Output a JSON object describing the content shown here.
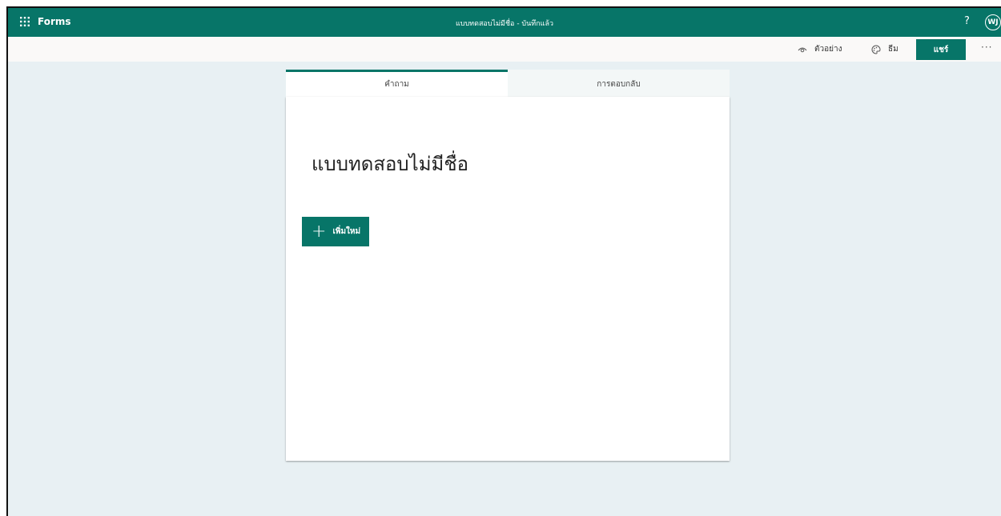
{
  "header": {
    "app_name": "Forms",
    "doc_title": "แบบทดสอบไม่มีชื่อ - บันทึกแล้ว",
    "help_label": "?",
    "avatar_initials": "WJ",
    "icons": {
      "launcher": "waffle-icon"
    }
  },
  "commandbar": {
    "preview_label": "ตัวอย่าง",
    "theme_label": "ธีม",
    "share_label": "แชร์",
    "more_label": "···",
    "icons": {
      "preview": "eye-icon",
      "theme": "palette-icon"
    }
  },
  "tabs": [
    {
      "label": "คำถาม",
      "active": true
    },
    {
      "label": "การตอบกลับ",
      "active": false
    }
  ],
  "form": {
    "title": "แบบทดสอบไม่มีชื่อ",
    "add_new_label": "เพิ่มใหม่",
    "add_icon": "plus-icon"
  },
  "colors": {
    "brand": "#077568",
    "page_background": "#e8f0f3",
    "card_background": "#ffffff"
  }
}
